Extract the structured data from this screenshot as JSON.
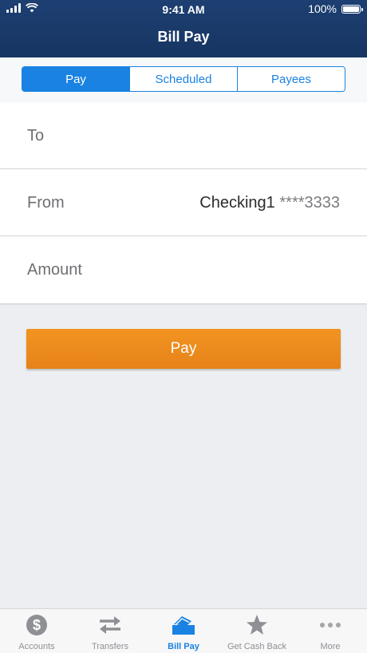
{
  "status_bar": {
    "time": "9:41 AM",
    "battery": "100%"
  },
  "header": {
    "title": "Bill Pay"
  },
  "segments": [
    {
      "label": "Pay",
      "active": true
    },
    {
      "label": "Scheduled",
      "active": false
    },
    {
      "label": "Payees",
      "active": false
    }
  ],
  "form": {
    "to_label": "To",
    "from_label": "From",
    "from_account": "Checking1",
    "from_mask": "****3333",
    "amount_label": "Amount"
  },
  "pay_button": {
    "label": "Pay"
  },
  "tab_bar": {
    "items": [
      {
        "label": "Accounts",
        "icon": "dollar-coin-icon"
      },
      {
        "label": "Transfers",
        "icon": "transfer-arrows-icon"
      },
      {
        "label": "Bill Pay",
        "icon": "bill-pay-icon",
        "active": true
      },
      {
        "label": "Get Cash Back",
        "icon": "star-icon"
      },
      {
        "label": "More",
        "icon": "more-dots-icon"
      }
    ]
  },
  "colors": {
    "header": "#1d3f72",
    "accent": "#1a82e2",
    "pay_button": "#ee8c1e",
    "background": "#eceef1"
  }
}
